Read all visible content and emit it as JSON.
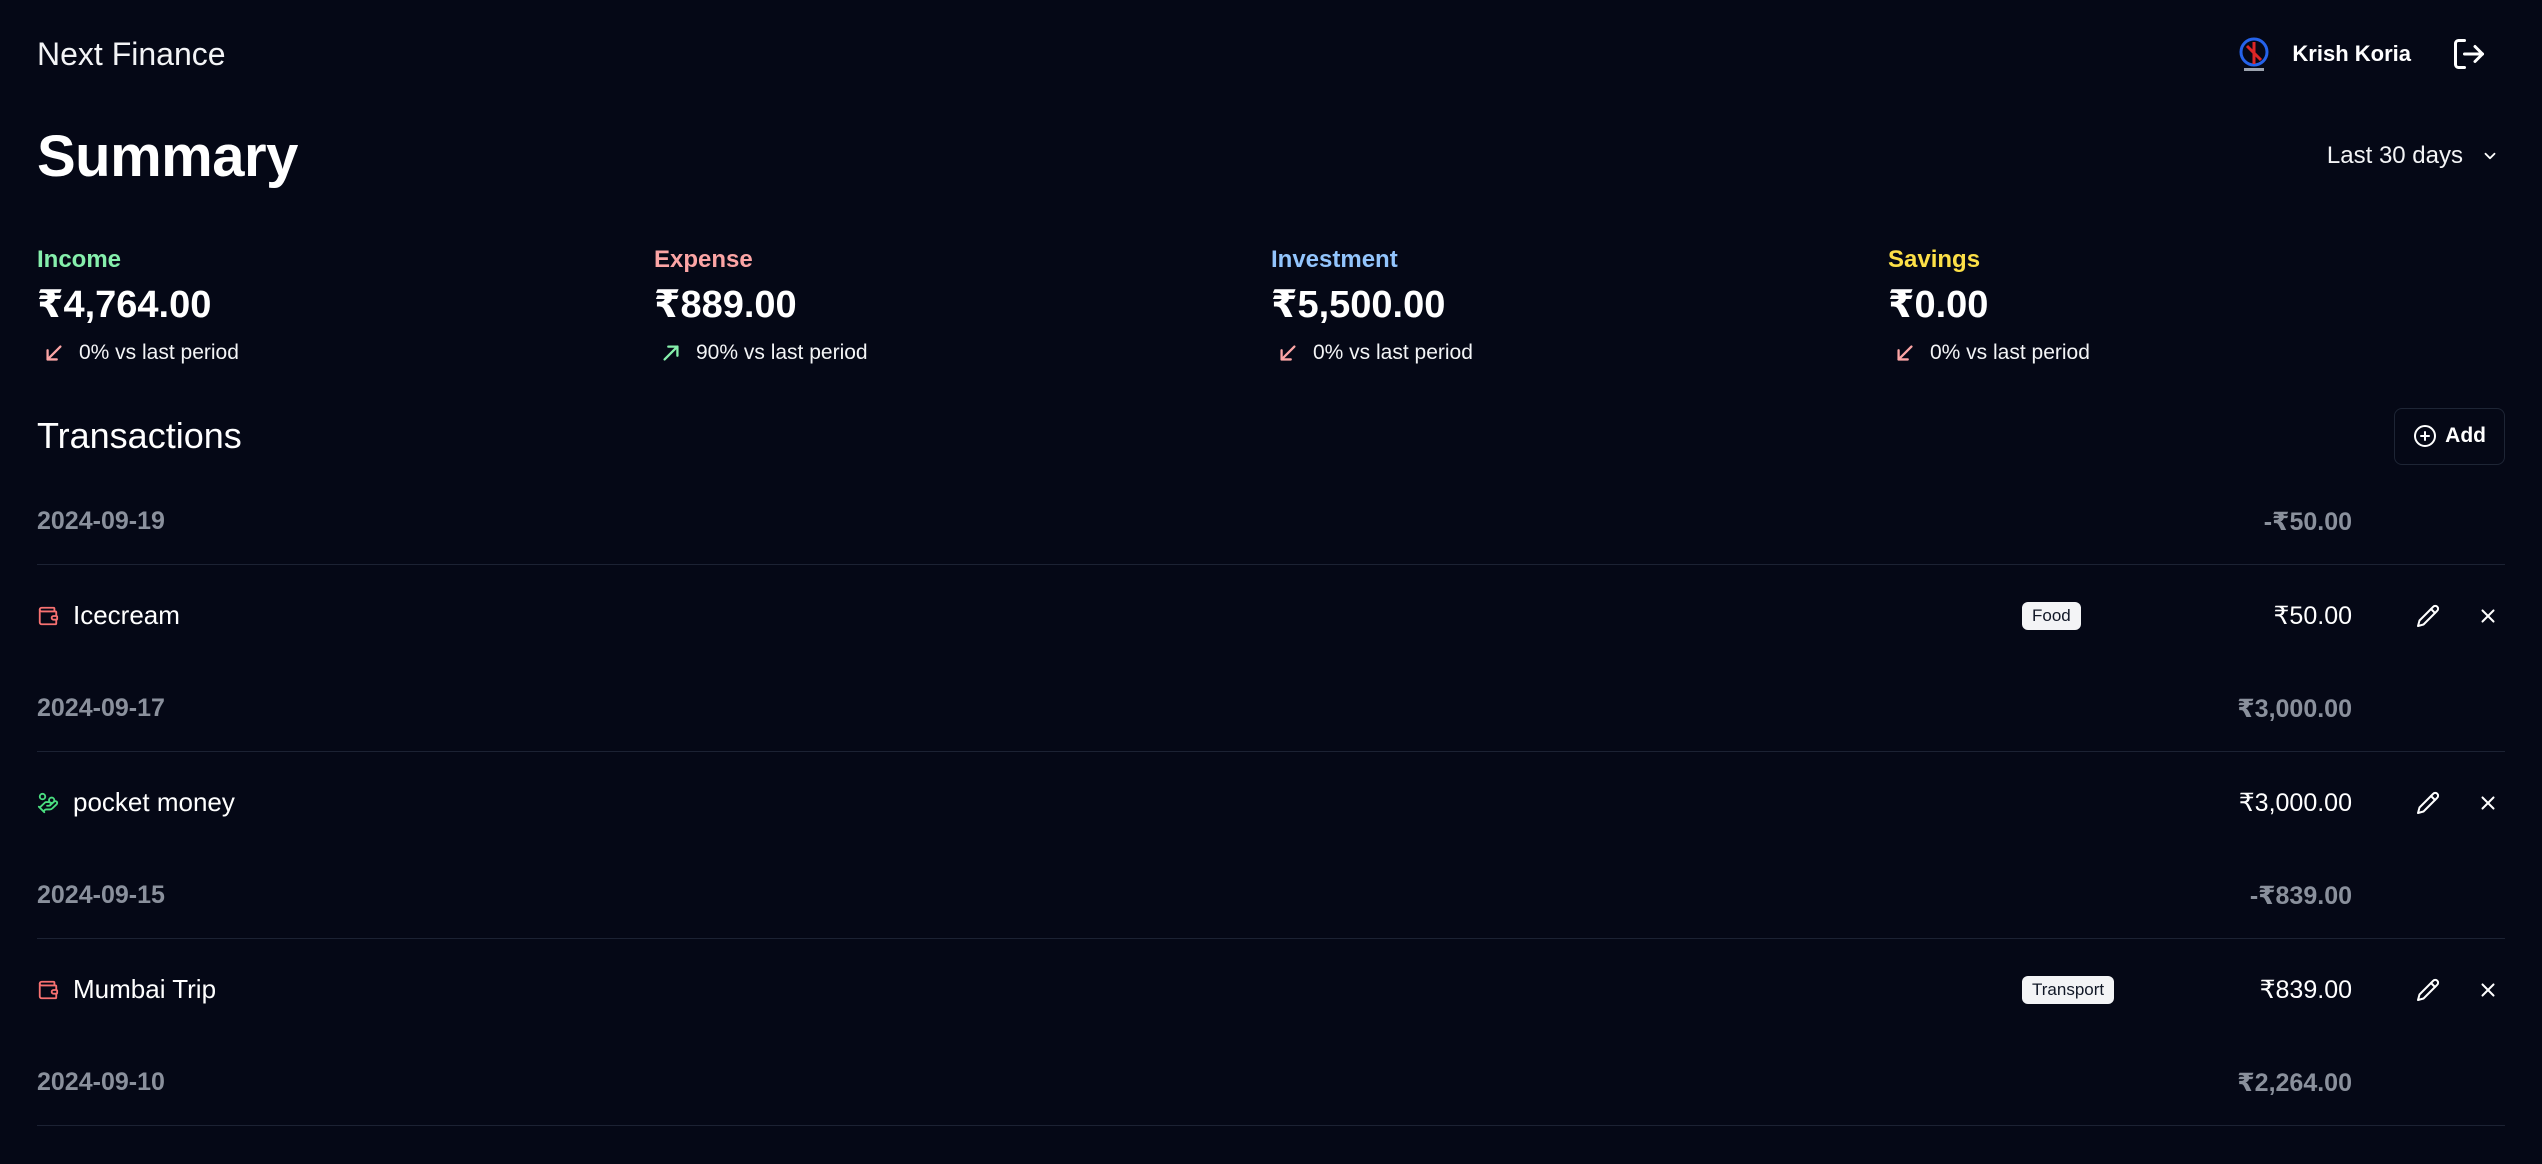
{
  "app": {
    "brand": "Next Finance"
  },
  "user": {
    "name": "Krish Koria",
    "avatar_icon": "user-avatar"
  },
  "summary": {
    "title": "Summary",
    "range_label": "Last 30 days",
    "stats": [
      {
        "label": "Income",
        "value": "₹4,764.00",
        "change": "0% vs last period",
        "trend": "down",
        "color": "#86efac"
      },
      {
        "label": "Expense",
        "value": "₹889.00",
        "change": "90% vs last period",
        "trend": "up",
        "color": "#fca5a5"
      },
      {
        "label": "Investment",
        "value": "₹5,500.00",
        "change": "0% vs last period",
        "trend": "down",
        "color": "#93c5fd"
      },
      {
        "label": "Savings",
        "value": "₹0.00",
        "change": "0% vs last period",
        "trend": "down",
        "color": "#fde047"
      }
    ]
  },
  "transactions": {
    "title": "Transactions",
    "add_label": "Add",
    "groups": [
      {
        "date": "2024-09-19",
        "total": "-₹50.00",
        "item": {
          "name": "Icecream",
          "category": "Food",
          "amount": "₹50.00",
          "type": "expense"
        }
      },
      {
        "date": "2024-09-17",
        "total": "₹3,000.00",
        "item": {
          "name": "pocket money",
          "category": "",
          "amount": "₹3,000.00",
          "type": "income"
        }
      },
      {
        "date": "2024-09-15",
        "total": "-₹839.00",
        "item": {
          "name": "Mumbai Trip",
          "category": "Transport",
          "amount": "₹839.00",
          "type": "expense"
        }
      },
      {
        "date": "2024-09-10",
        "total": "₹2,264.00"
      }
    ]
  },
  "colors": {
    "background": "#050816",
    "trend_up": "#86efac",
    "trend_down": "#fca5a5",
    "muted": "#8a909c"
  }
}
